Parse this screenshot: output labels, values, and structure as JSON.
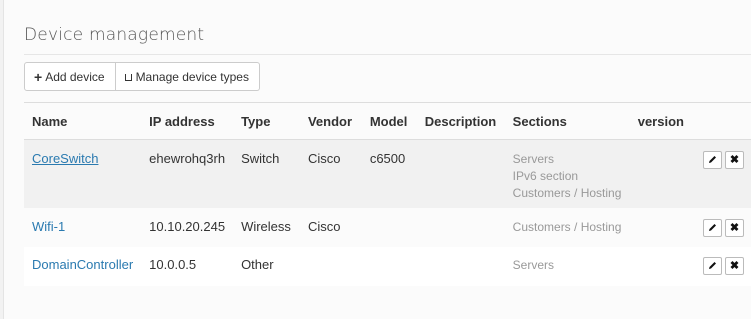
{
  "page": {
    "title": "Device management",
    "add_label": "Add device",
    "types_label": "Manage device types"
  },
  "table": {
    "headers": [
      "Name",
      "IP address",
      "Type",
      "Vendor",
      "Model",
      "Description",
      "Sections",
      "version"
    ],
    "rows": [
      {
        "name": "CoreSwitch",
        "ip": "ehewrohq3rh",
        "type": "Switch",
        "vendor": "Cisco",
        "model": "c6500",
        "description": "",
        "sections": [
          "Servers",
          "IPv6 section",
          "Customers / Hosting"
        ],
        "version": ""
      },
      {
        "name": "Wifi-1",
        "ip": "10.10.20.245",
        "type": "Wireless",
        "vendor": "Cisco",
        "model": "",
        "description": "",
        "sections": [
          "Customers / Hosting"
        ],
        "version": ""
      },
      {
        "name": "DomainController",
        "ip": "10.0.0.5",
        "type": "Other",
        "vendor": "",
        "model": "",
        "description": "",
        "sections": [
          "Servers"
        ],
        "version": ""
      }
    ]
  },
  "icons": {
    "add": "plus-icon",
    "types": "book-icon",
    "edit": "pencil-icon",
    "delete": "close-icon"
  },
  "colors": {
    "link": "#2a7ab0",
    "muted": "#999999"
  }
}
